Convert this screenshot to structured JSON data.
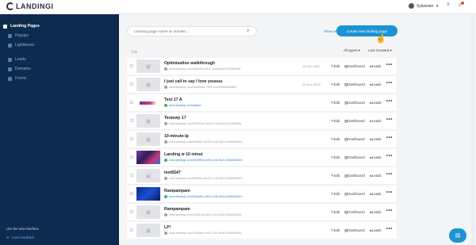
{
  "app": {
    "logo_text": "LANDINGI",
    "user_name": "Sylwester",
    "help_label": "?",
    "notifications_icon": "bell-icon"
  },
  "sidebar": {
    "items": [
      {
        "label": "Landing Pages",
        "icon": "landing-icon",
        "active": true
      },
      {
        "label": "Popups",
        "icon": "popup-icon",
        "active": false
      },
      {
        "label": "Lightboxes",
        "icon": "lightbox-icon",
        "active": false
      },
      {
        "label": "Leads",
        "icon": "leads-icon",
        "active": false
      },
      {
        "label": "Domains",
        "icon": "domains-icon",
        "active": false
      },
      {
        "label": "Forms",
        "icon": "forms-icon",
        "active": false
      }
    ],
    "footer_text": "Like the new interface",
    "footer_link": "Learn feedback"
  },
  "toolbar": {
    "search_placeholder": "Landing page name or domain...",
    "show_archived": "Show archived",
    "create_label": "Create new landing page",
    "filter_type": "All types",
    "sort_label": "Last Created"
  },
  "actions": {
    "edit": "Edit",
    "dashboard": "Dashboard",
    "leads": "Leads",
    "more": "•••"
  },
  "rows": [
    {
      "title": "Optimisation walkthrough",
      "url": "www.landingi.com/b38f4f2a-9d47-1b2caed4-9f1d3b62b8",
      "date": "18 Feb 2020",
      "published": false,
      "thumb": "placeholder"
    },
    {
      "title": "I just call to say I love youuuu",
      "url": "www.landingi.com/2ac98d5e-7f2f11-be0b9d48b8a83c",
      "date": "26 Nov 2019",
      "published": false,
      "thumb": "placeholder"
    },
    {
      "title": "Test 17 A",
      "url": "www.landingi.com/taktest",
      "date": "",
      "published": true,
      "thumb": "strip"
    },
    {
      "title": "Testowy 17",
      "url": "www.landingi.com/b83f82ae-ba2f3-7c3a-bd12b1bd6828d",
      "date": "",
      "published": false,
      "thumb": "placeholder"
    },
    {
      "title": "10-minute-lp",
      "url": "www.landingi.com/9a2f82c-ab4f3-11d4-bb2c-f25d6828d2c",
      "date": "",
      "published": false,
      "thumb": "placeholder"
    },
    {
      "title": "Landing w 10 minut",
      "url": "www.landingi.com/d0d4f85-cd4f3-11d4-bb21-f25d6828d2e",
      "date": "",
      "published": true,
      "thumb": "photo"
    },
    {
      "title": "test5547",
      "url": "www.landingi.com/b83f82c-ab4f3-11d4-bb2c-f25d6828d2c",
      "date": "",
      "published": false,
      "thumb": "placeholder"
    },
    {
      "title": "Rampampam",
      "url": "www.landingi.com/60b6a9c-cf4f3-11d4-bb2b-f25d6828d2c",
      "date": "",
      "published": true,
      "thumb": "blue"
    },
    {
      "title": "Rampampam",
      "url": "www.landingi.com/f7a0f1d4-a4f3-11d4-bb2b-f25d6828d2c",
      "date": "",
      "published": false,
      "thumb": "placeholder"
    },
    {
      "title": "LP!",
      "url": "www.landingi.com/1d0b9be-c4f3-11d4-bb2b-f25d6828d2c",
      "date": "",
      "published": false,
      "thumb": "placeholder"
    }
  ],
  "chat_icon": "chat-icon"
}
